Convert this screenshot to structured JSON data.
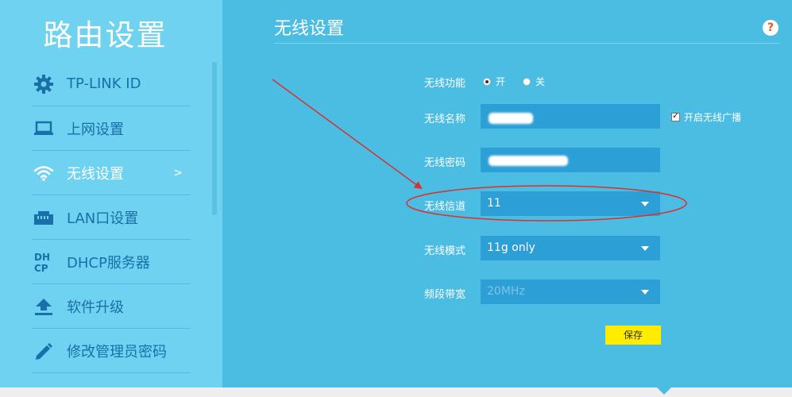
{
  "app": {
    "brand": "路由设置"
  },
  "sidebar": {
    "items": [
      {
        "label": "TP-LINK ID",
        "icon": "gear-icon"
      },
      {
        "label": "上网设置",
        "icon": "laptop-icon"
      },
      {
        "label": "无线设置",
        "icon": "wifi-icon",
        "active": true,
        "arrow": ">"
      },
      {
        "label": "LAN口设置",
        "icon": "ethernet-port-icon"
      },
      {
        "label": "DHCP服务器",
        "icon": "dhcp-icon",
        "icon_text_top": "DH",
        "icon_text_bottom": "CP"
      },
      {
        "label": "软件升级",
        "icon": "upload-icon"
      },
      {
        "label": "修改管理员密码",
        "icon": "pencil-icon"
      }
    ]
  },
  "page": {
    "title": "无线设置",
    "help": "?"
  },
  "form": {
    "wireless_function": {
      "label": "无线功能",
      "on_label": "开",
      "off_label": "关",
      "selected": "开"
    },
    "ssid": {
      "label": "无线名称",
      "value": ""
    },
    "broadcast": {
      "label": "开启无线广播",
      "checked": true
    },
    "password": {
      "label": "无线密码",
      "value": ""
    },
    "channel": {
      "label": "无线信道",
      "value": "11"
    },
    "mode": {
      "label": "无线模式",
      "value": "11g only"
    },
    "bandwidth": {
      "label": "频段带宽",
      "value": "20MHz"
    },
    "save_label": "保存"
  },
  "colors": {
    "background": "#4bbde2",
    "sidebar": "#6fd2f0",
    "nav_text": "#1a6fa8",
    "field": "#2d9fd7",
    "save_button": "#ffec00",
    "annotation": "#d9312c"
  }
}
